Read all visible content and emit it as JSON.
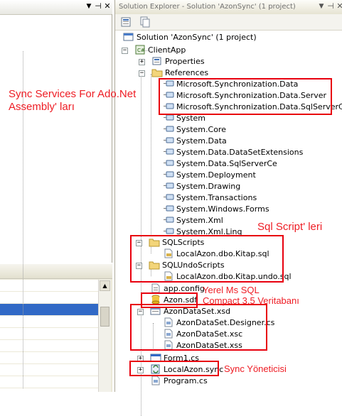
{
  "solution_explorer": {
    "title": "Solution Explorer - Solution 'AzonSync' (1 project)",
    "tree": [
      {
        "label": "Solution 'AzonSync' (1 project)",
        "icon": "solution-icon"
      },
      {
        "label": "ClientApp",
        "icon": "csharp-project-icon"
      },
      {
        "label": "Properties",
        "icon": "properties-icon"
      },
      {
        "label": "References",
        "icon": "folder-icon"
      },
      {
        "label": "Microsoft.Synchronization.Data",
        "icon": "reference-icon"
      },
      {
        "label": "Microsoft.Synchronization.Data.Server",
        "icon": "reference-icon"
      },
      {
        "label": "Microsoft.Synchronization.Data.SqlServerCe",
        "icon": "reference-icon"
      },
      {
        "label": "System",
        "icon": "reference-icon"
      },
      {
        "label": "System.Core",
        "icon": "reference-icon"
      },
      {
        "label": "System.Data",
        "icon": "reference-icon"
      },
      {
        "label": "System.Data.DataSetExtensions",
        "icon": "reference-icon"
      },
      {
        "label": "System.Data.SqlServerCe",
        "icon": "reference-icon"
      },
      {
        "label": "System.Deployment",
        "icon": "reference-icon"
      },
      {
        "label": "System.Drawing",
        "icon": "reference-icon"
      },
      {
        "label": "System.Transactions",
        "icon": "reference-icon"
      },
      {
        "label": "System.Windows.Forms",
        "icon": "reference-icon"
      },
      {
        "label": "System.Xml",
        "icon": "reference-icon"
      },
      {
        "label": "System.Xml.Linq",
        "icon": "reference-icon"
      },
      {
        "label": "SQLScripts",
        "icon": "folder-icon"
      },
      {
        "label": "LocalAzon.dbo.Kitap.sql",
        "icon": "sql-file-icon"
      },
      {
        "label": "SQLUndoScripts",
        "icon": "folder-icon"
      },
      {
        "label": "LocalAzon.dbo.Kitap.undo.sql",
        "icon": "sql-file-icon"
      },
      {
        "label": "app.config",
        "icon": "config-file-icon"
      },
      {
        "label": "Azon.sdf",
        "icon": "database-icon"
      },
      {
        "label": "AzonDataSet.xsd",
        "icon": "dataset-icon"
      },
      {
        "label": "AzonDataSet.Designer.cs",
        "icon": "cs-file-icon"
      },
      {
        "label": "AzonDataSet.xsc",
        "icon": "cs-file-icon"
      },
      {
        "label": "AzonDataSet.xss",
        "icon": "cs-file-icon"
      },
      {
        "label": "Form1.cs",
        "icon": "form-icon"
      },
      {
        "label": "LocalAzon.sync",
        "icon": "sync-file-icon"
      },
      {
        "label": "Program.cs",
        "icon": "cs-file-icon"
      }
    ]
  },
  "annotations": {
    "sync_services": "Sync Services For Ado.Net\nAssembly' ları",
    "sql_scripts": "Sql Script' leri",
    "local_db": "Yerel Ms SQL\nCompact 3.5 Veritabanı",
    "sync_manager": "Sync Yöneticisi"
  },
  "colors": {
    "annotation": "#ee1c24",
    "highlight_box": "#e8000e",
    "selection": "#3169c6"
  }
}
